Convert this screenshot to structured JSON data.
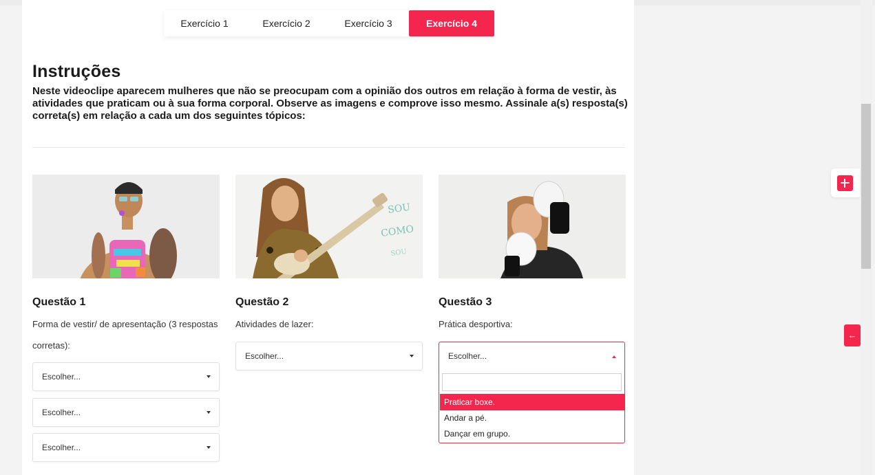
{
  "tabs": [
    {
      "label": "Exercício 1",
      "active": false
    },
    {
      "label": "Exercício 2",
      "active": false
    },
    {
      "label": "Exercício 3",
      "active": false
    },
    {
      "label": "Exercício 4",
      "active": true
    }
  ],
  "instructions": {
    "title": "Instruções",
    "text": "Neste videoclipe aparecem mulheres que não se preocupam com a opinião dos outros em relação à forma de vestir, às atividades que praticam ou à sua forma corporal. Observe as imagens e comprove isso mesmo. Assinale a(s) resposta(s) correta(s) em relação a cada um dos seguintes tópicos:"
  },
  "images": {
    "img2_wall_text": [
      "SOU",
      "COMO",
      "SOU"
    ]
  },
  "questions": [
    {
      "title": "Questão 1",
      "description": "Forma de vestir/ de apresentação (3 respostas corretas):",
      "selects": [
        "Escolher...",
        "Escolher...",
        "Escolher..."
      ]
    },
    {
      "title": "Questão 2",
      "description": "Atividades de lazer:",
      "selects": [
        "Escolher..."
      ]
    },
    {
      "title": "Questão 3",
      "description": "Prática desportiva:",
      "selects": [
        "Escolher..."
      ],
      "open_dropdown": {
        "search_value": "",
        "options": [
          "Praticar boxe.",
          "Andar a pé.",
          "Dançar em grupo."
        ],
        "highlighted_index": 0
      }
    }
  ],
  "side_controls": {
    "add_icon": "plus-icon",
    "back_icon": "arrow-left-icon",
    "back_label": "←"
  },
  "colors": {
    "accent": "#f5264e",
    "background": "#f3f3f3",
    "panel": "#ffffff"
  }
}
